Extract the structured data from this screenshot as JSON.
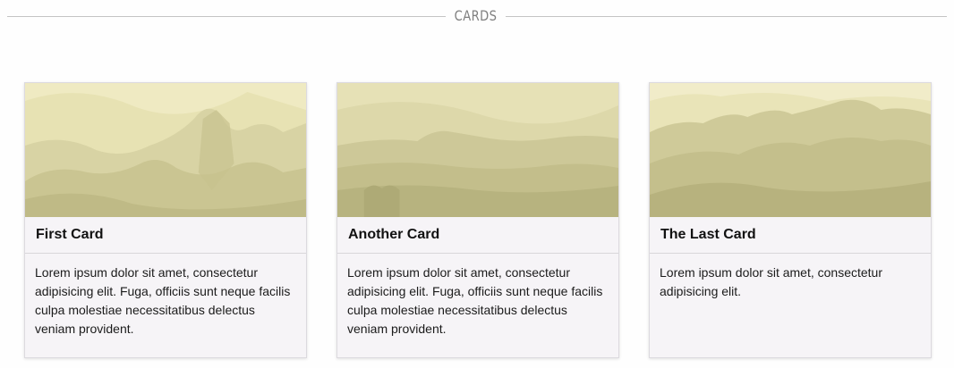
{
  "section": {
    "title": "CARDS"
  },
  "cards": [
    {
      "title": "First Card",
      "body": "Lorem ipsum dolor sit amet, consectetur adipisicing elit. Fuga, officiis sunt neque facilis culpa molestiae necessitatibus delectus veniam provident.",
      "image": "mountain-landscape-image"
    },
    {
      "title": "Another Card",
      "body": "Lorem ipsum dolor sit amet, consectetur adipisicing elit. Fuga, officiis sunt neque facilis culpa molestiae necessitatibus delectus veniam provident.",
      "image": "mountain-range-image"
    },
    {
      "title": "The Last Card",
      "body": "Lorem ipsum dolor sit amet, consectetur adipisicing elit.",
      "image": "mountain-peaks-image"
    }
  ],
  "colors": {
    "image_tint": "#d6d3a2",
    "card_background": "#f6f4f7",
    "header_text": "#7f7f7f"
  }
}
